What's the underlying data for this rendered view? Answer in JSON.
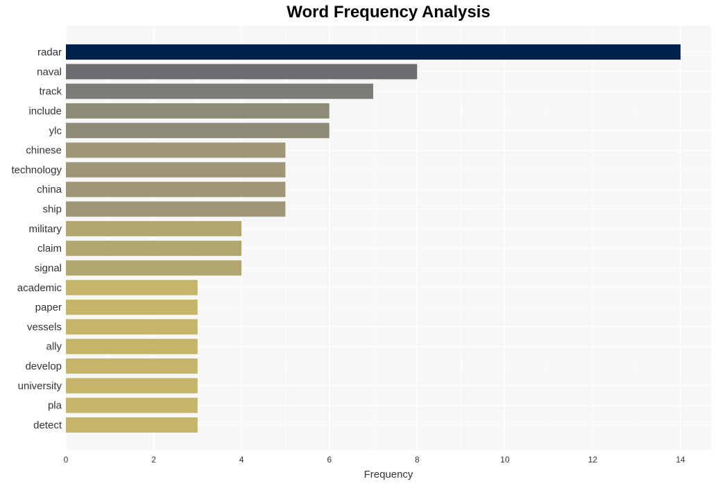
{
  "chart_data": {
    "type": "bar",
    "orientation": "horizontal",
    "title": "Word Frequency Analysis",
    "xlabel": "Frequency",
    "ylabel": "",
    "xlim": [
      0,
      14.7
    ],
    "xticks": [
      0,
      2,
      4,
      6,
      8,
      10,
      12,
      14
    ],
    "grid": true,
    "categories": [
      "radar",
      "naval",
      "track",
      "include",
      "ylc",
      "chinese",
      "technology",
      "china",
      "ship",
      "military",
      "claim",
      "signal",
      "academic",
      "paper",
      "vessels",
      "ally",
      "develop",
      "university",
      "pla",
      "detect"
    ],
    "values": [
      14,
      8,
      7,
      6,
      6,
      5,
      5,
      5,
      5,
      4,
      4,
      4,
      3,
      3,
      3,
      3,
      3,
      3,
      3,
      3
    ],
    "colors": [
      "#00204e",
      "#6c6e72",
      "#7c7b78",
      "#8e8a78",
      "#8e8a78",
      "#9f9677",
      "#9f9677",
      "#9f9677",
      "#9f9677",
      "#b1a570",
      "#b1a570",
      "#b1a570",
      "#c5b56a",
      "#c5b56a",
      "#c5b56a",
      "#c5b56a",
      "#c5b56a",
      "#c5b56a",
      "#c5b56a",
      "#c5b56a"
    ],
    "plot_background": "#f7f7f7"
  }
}
